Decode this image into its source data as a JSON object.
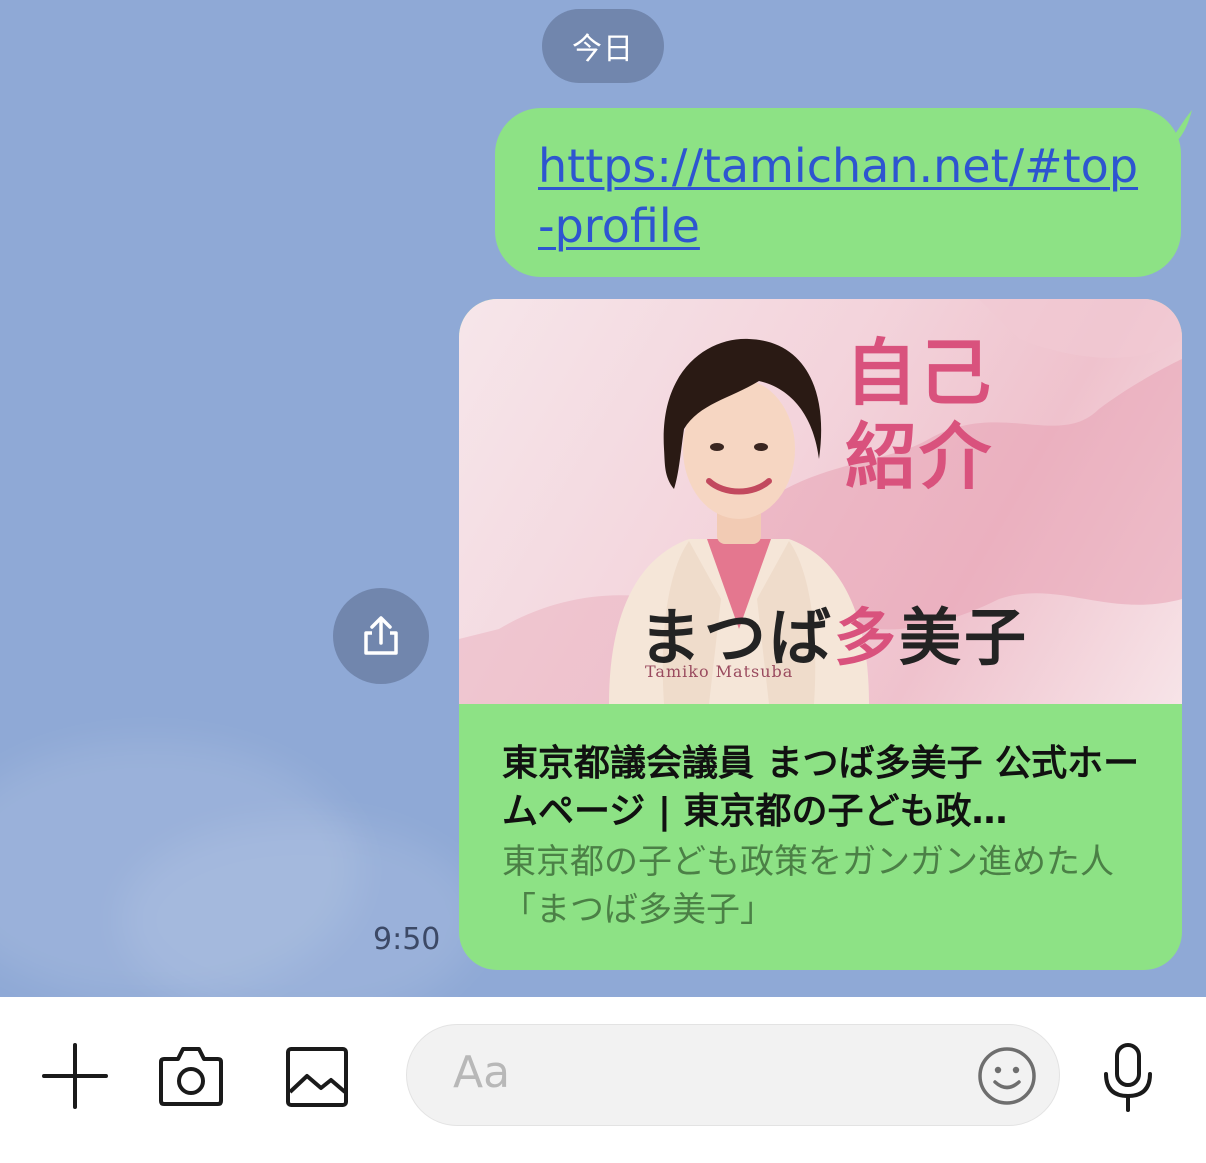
{
  "chat": {
    "date_label": "今日",
    "message_url": "https://tamichan.net/#top-profile",
    "link_card": {
      "image_heading": "自己紹介",
      "image_name_part1": "まつば",
      "image_name_accent": "多",
      "image_name_part2": "美子",
      "image_name_romaji": "Tamiko Matsuba",
      "title": "東京都議会議員 まつば多美子 公式ホームページ | 東京都の子ども政…",
      "description": "東京都の子ども政策をガンガン進めた人「まつば多美子」"
    },
    "timestamp": "9:50"
  },
  "toolbar": {
    "input_placeholder": "Aa",
    "icons": [
      "plus-icon",
      "camera-icon",
      "image-icon",
      "emoji-icon",
      "microphone-icon"
    ]
  },
  "colors": {
    "chat_background": "#8fa9d6",
    "bubble_green": "#8de285",
    "pill": "#7186ad",
    "link": "#2e55d0",
    "accent_pink": "#d9527d"
  }
}
